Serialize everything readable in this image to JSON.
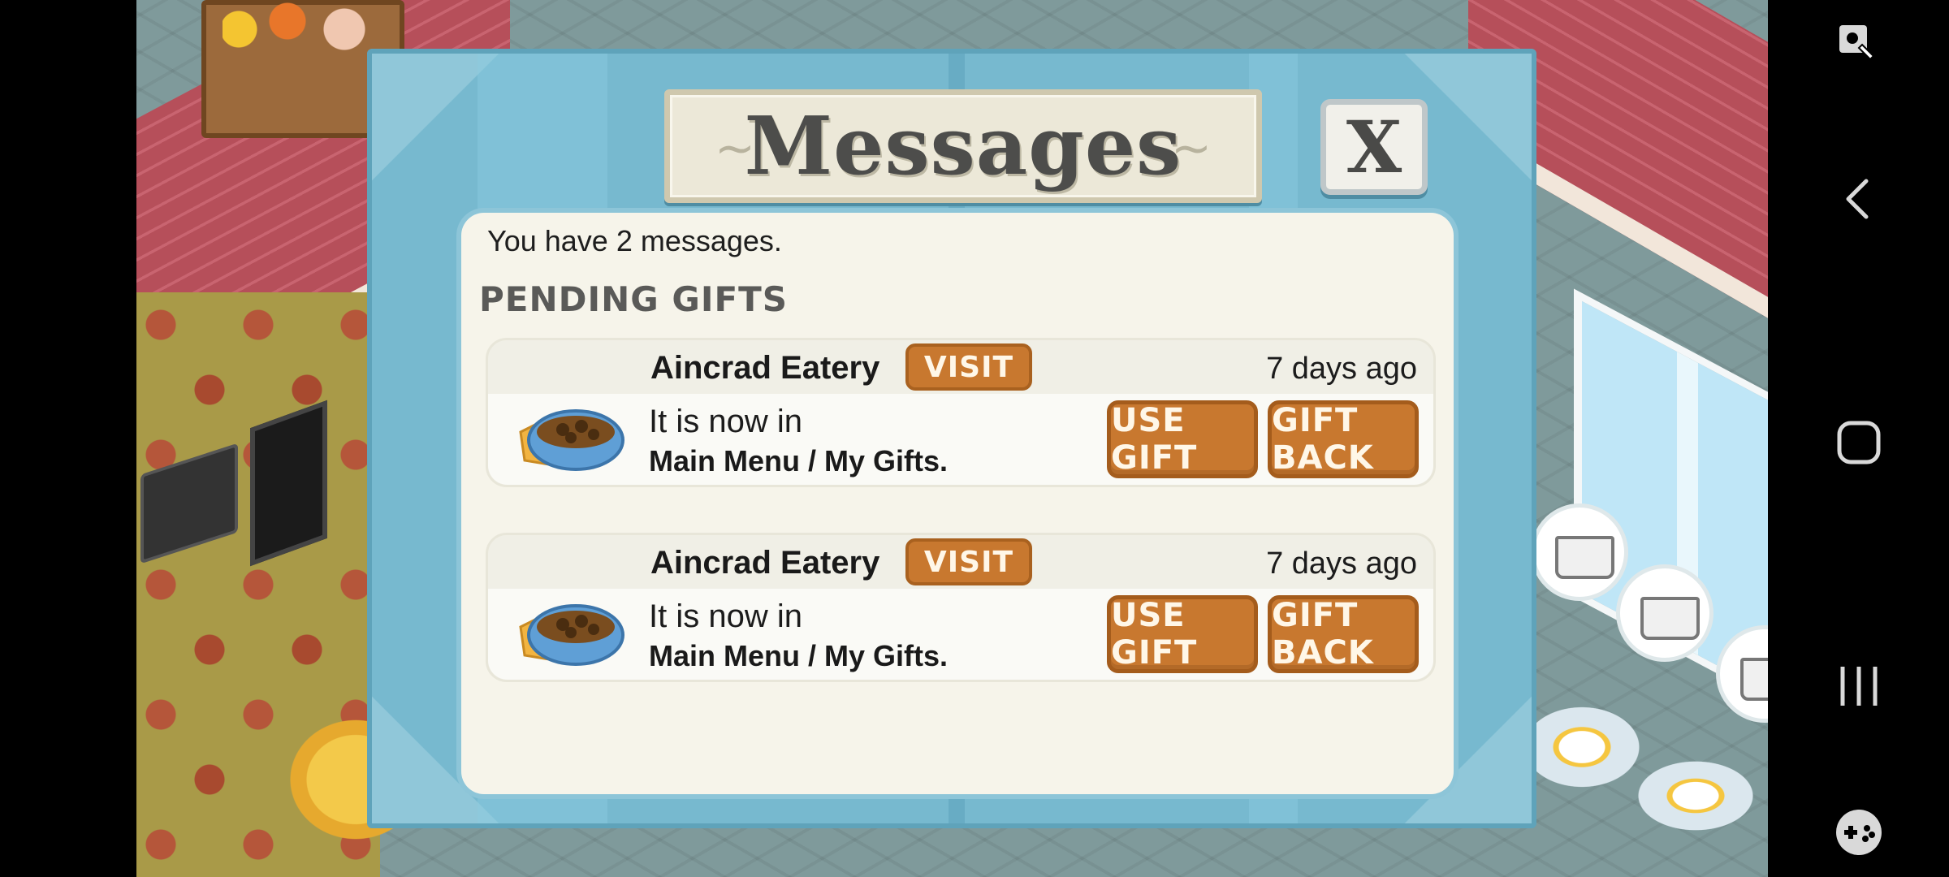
{
  "dialog": {
    "title": "Messages",
    "close_label": "X",
    "summary": "You have 2 messages.",
    "section_title": "PENDING GIFTS"
  },
  "messages": [
    {
      "sender": "Aincrad Eatery",
      "visit_label": "VISIT",
      "time": "7 days ago",
      "line1": "It is now in",
      "line2": "Main Menu / My Gifts.",
      "use_label": "USE GIFT",
      "back_label": "GIFT BACK",
      "icon": "soup-bowl-icon"
    },
    {
      "sender": "Aincrad Eatery",
      "visit_label": "VISIT",
      "time": "7 days ago",
      "line1": "It is now in",
      "line2": "Main Menu / My Gifts.",
      "use_label": "USE GIFT",
      "back_label": "GIFT BACK",
      "icon": "soup-bowl-icon"
    }
  ],
  "system_nav": {
    "icons": [
      "assistant-touch-icon",
      "back-icon",
      "home-icon",
      "recent-apps-icon",
      "game-controller-icon"
    ]
  },
  "colors": {
    "dialog_blue": "#77b9cf",
    "button_orange": "#c8782f",
    "panel_cream": "#f6f4ea"
  }
}
